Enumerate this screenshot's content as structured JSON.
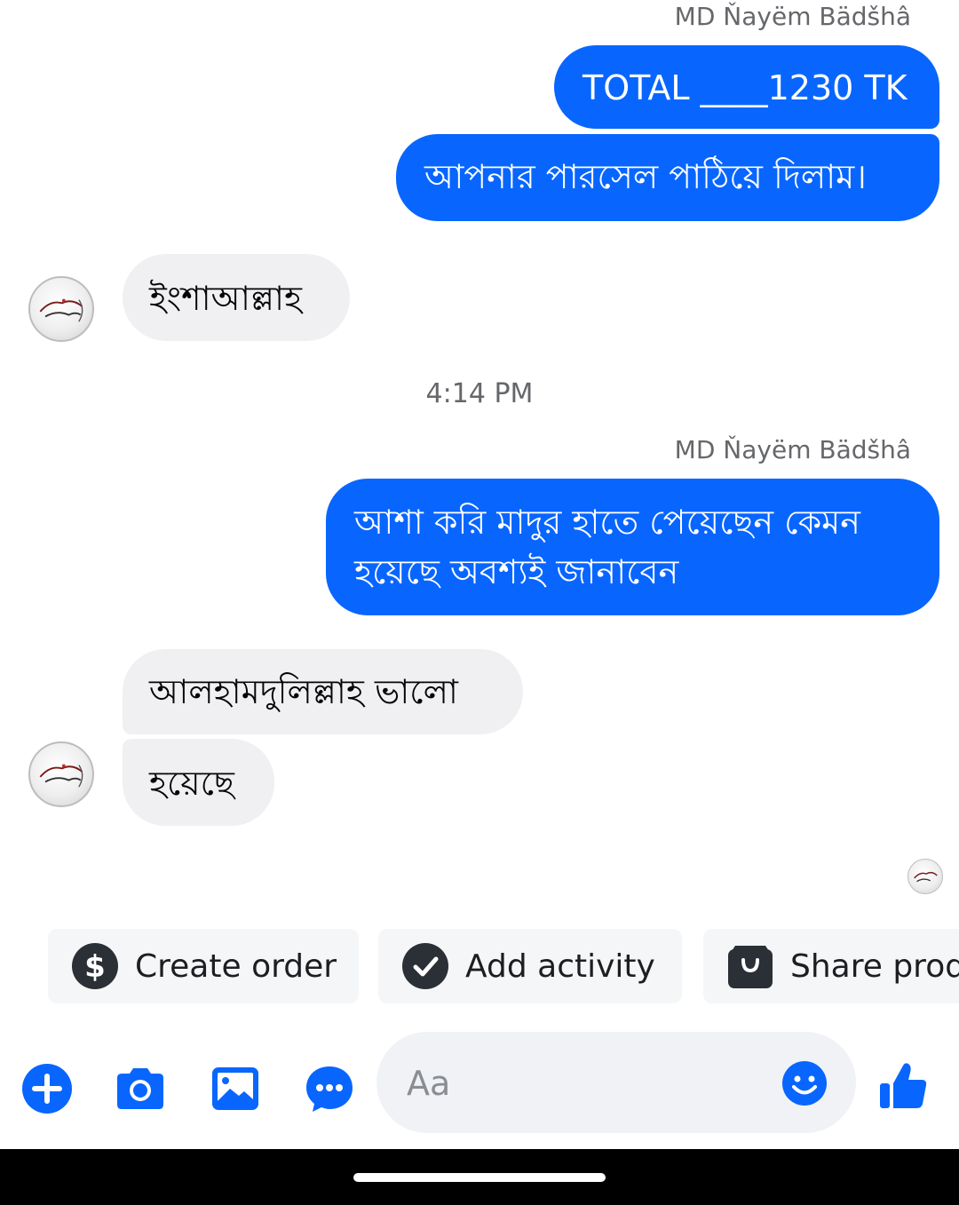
{
  "colors": {
    "accent": "#0866ff",
    "incoming_bubble": "#f0f0f3",
    "meta_text": "#65676b"
  },
  "messages": {
    "sender_name_1": "MD Ňayëm Bädšhâ",
    "out_1": "TOTAL ____1230 TK",
    "out_2": "আপনার পারসেল পাঠিয়ে দিলাম।",
    "in_1": "ইংশাআল্লাহ",
    "timestamp": "4:14 PM",
    "sender_name_2": "MD Ňayëm Bädšhâ",
    "out_3_line_1": "আশা করি মাদুর হাতে পেয়েছেন কেমন",
    "out_3_line_2": "হয়েছে অবশ্যই জানাবেন",
    "in_2": "আলহামদুলিল্লাহ  ভালো",
    "in_3": "হয়েছে"
  },
  "quick_actions": [
    {
      "label": "Create order",
      "icon": "dollar-circle-icon"
    },
    {
      "label": "Add activity",
      "icon": "check-circle-icon"
    },
    {
      "label": "Share products",
      "icon": "shopping-bag-icon"
    }
  ],
  "toolbar": {
    "icons": [
      "plus-circle-icon",
      "camera-icon",
      "image-icon",
      "chat-bubble-icon"
    ],
    "send_icon": "thumbs-up-icon"
  },
  "composer": {
    "placeholder": "Aa",
    "emoji_icon": "smiley-icon"
  }
}
